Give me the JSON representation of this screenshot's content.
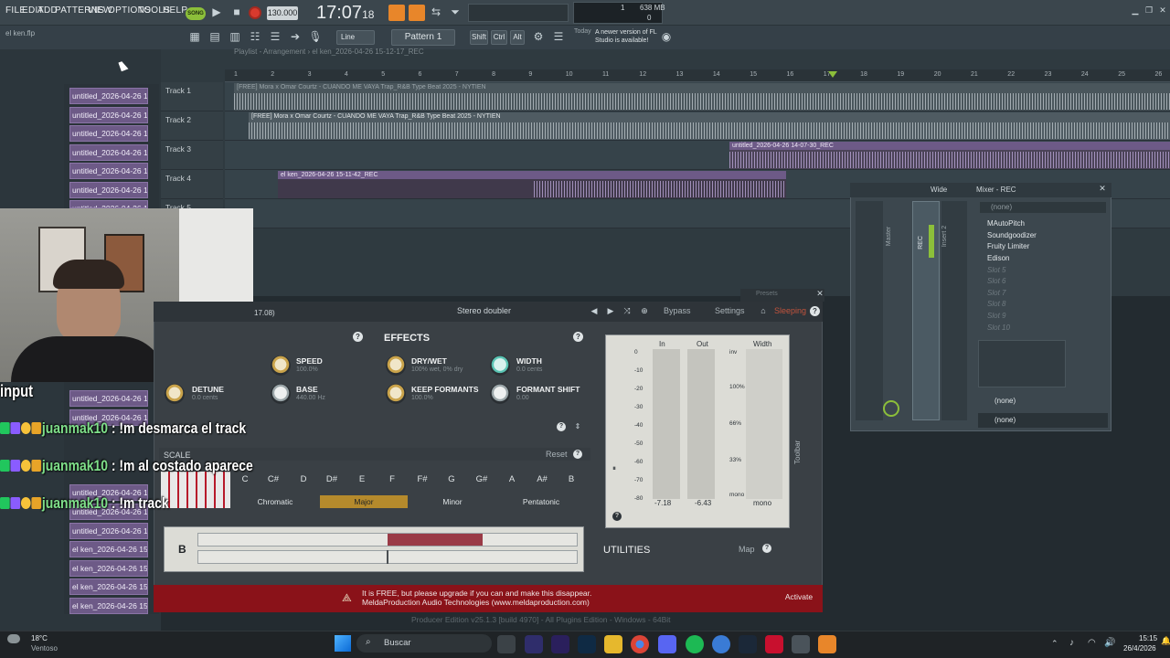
{
  "menu": [
    "FILE",
    "EDIT",
    "ADD",
    "PATTERNS",
    "VIEW",
    "OPTIONS",
    "TOOLS",
    "HELP"
  ],
  "transport": {
    "song_mode": "SONG",
    "tempo": "130.000",
    "time": "17:07",
    "time_sub": "18",
    "cpu_top": "1",
    "mem": "638 MB",
    "cpu_bottom": "0"
  },
  "toolbar2": {
    "snap": "Line",
    "pattern": "Pattern 1",
    "mods": [
      "Shift",
      "Ctrl",
      "Alt"
    ],
    "news_date": "Today",
    "news_text": "A newer version of FL Studio is available!"
  },
  "browser": {
    "project_label": "el ken.flp",
    "clips": [
      "untitled_2026-04-26 12-...",
      "untitled_2026-04-26 12-...",
      "untitled_2026-04-26 12-...",
      "untitled_2026-04-26 12-...",
      "untitled_2026-04-26 12-...",
      "untitled_2026-04-26 12-...",
      "untitled_2026-04-26 12-...",
      "untitled_2026-04-26 14-...",
      "untitled_2026-04-26 14-...",
      "untitled_2026-04-26 14-...",
      "untitled_2026-04-26 14-...",
      "untitled_2026-04-26 14-...",
      "untitled_2026-04-26 14-...",
      "untitled_2026-04-26 14-...",
      "el ken_2026-04-26 15-1...",
      "el ken_2026-04-26 15-1...",
      "el ken_2026-04-26 15-1...",
      "el ken_2026-04-26 15-1..."
    ]
  },
  "playlist": {
    "title": "Playlist - Arrangement › el ken_2026-04-26 15-12-17_REC",
    "ruler": [
      "1",
      "2",
      "3",
      "4",
      "5",
      "6",
      "7",
      "8",
      "9",
      "10",
      "11",
      "12",
      "13",
      "14",
      "15",
      "16",
      "17",
      "18",
      "19",
      "20",
      "21",
      "22",
      "23",
      "24",
      "25",
      "26"
    ],
    "tracks": [
      "Track 1",
      "Track 2",
      "Track 3",
      "Track 4",
      "Track 5"
    ],
    "clips": {
      "beat1": "[FREE] Mora x Omar Courtz - CUANDO ME VAYA  Trap_R&B Type Beat 2025 - NYTIEN",
      "beat2": "[FREE] Mora x Omar Courtz - CUANDO ME VAYA  Trap_R&B Type Beat 2025 - NYTIEN",
      "rec1": "untitled_2026-04-26 14-07-30_REC",
      "rec2": "el ken_2026-04-26 15-11-42_REC"
    }
  },
  "plugin": {
    "time_label": "17.08)",
    "preset": "Stereo doubler",
    "header_buttons": [
      "Bypass",
      "Settings",
      "Sleeping"
    ],
    "presets_label": "Presets",
    "effects_title": "EFFECTS",
    "knobs": [
      {
        "label": "SPEED",
        "value": "100.0%"
      },
      {
        "label": "DETUNE",
        "value": "0.0 cents"
      },
      {
        "label": "BASE",
        "value": "440.00 Hz"
      },
      {
        "label": "DRY/WET",
        "value": "100% wet, 0% dry"
      },
      {
        "label": "KEEP FORMANTS",
        "value": "100.0%"
      },
      {
        "label": "WIDTH",
        "value": "0.0 cents"
      },
      {
        "label": "FORMANT SHIFT",
        "value": "0.00"
      }
    ],
    "scale_title": "SCALE",
    "reset": "Reset",
    "notes": [
      "C",
      "C#",
      "D",
      "D#",
      "E",
      "F",
      "F#",
      "G",
      "G#",
      "A",
      "A#",
      "B"
    ],
    "scale_modes": [
      "Chromatic",
      "Major",
      "Minor",
      "Pentatonic"
    ],
    "selected_mode": "Major",
    "key": "B",
    "meter": {
      "headers": [
        "In",
        "Out",
        "Width"
      ],
      "db_ticks": [
        "0",
        "-10",
        "-20",
        "-30",
        "-40",
        "-50",
        "-60",
        "-70",
        "-80"
      ],
      "width_ticks": [
        "inv",
        "100%",
        "66%",
        "33%",
        "mono"
      ],
      "in_val": "-7.18",
      "out_val": "-6.43",
      "width_val": "mono"
    },
    "utilities": "UTILITIES",
    "map": "Map",
    "toolbar_side": "Toolbar",
    "banner": "It is FREE, but please upgrade if you can and make this disappear.",
    "banner2": "MeldaProduction Audio Technologies (www.meldaproduction.com)",
    "activate": "Activate"
  },
  "mixer": {
    "title": "Mixer - REC",
    "mode": "Wide",
    "strips": [
      "Master",
      "REC",
      "Insert 2"
    ],
    "slots": [
      "MAutoPitch",
      "Soundgoodizer",
      "Fruity Limiter",
      "Edison",
      "Slot 5",
      "Slot 6",
      "Slot 7",
      "Slot 8",
      "Slot 9",
      "Slot 10"
    ],
    "top_slot": "(none)",
    "eq_slot": "(none)",
    "out_slot": "(none)"
  },
  "stream": {
    "input_label": "input",
    "chat": [
      {
        "user": "juanmak10",
        "msg": " : !m desmarca el track"
      },
      {
        "user": "juanmak10",
        "msg": " : !m al costado aparece"
      },
      {
        "user": "juanmak10",
        "msg": " : !m track"
      }
    ]
  },
  "taskbar": {
    "temp": "18°C",
    "weather": "Ventoso",
    "search": "Buscar",
    "time": "15:15",
    "date": "26/4/2026",
    "behind_text": "Producer Edition v25.1.3 [build 4970] - All Plugins Edition - Windows - 64Bit"
  },
  "colors": {
    "accent_orange": "#e8862a",
    "clip_purple": "#6d5a87",
    "banner_red": "#8a1219",
    "selected_mode": "#b58a2c"
  }
}
